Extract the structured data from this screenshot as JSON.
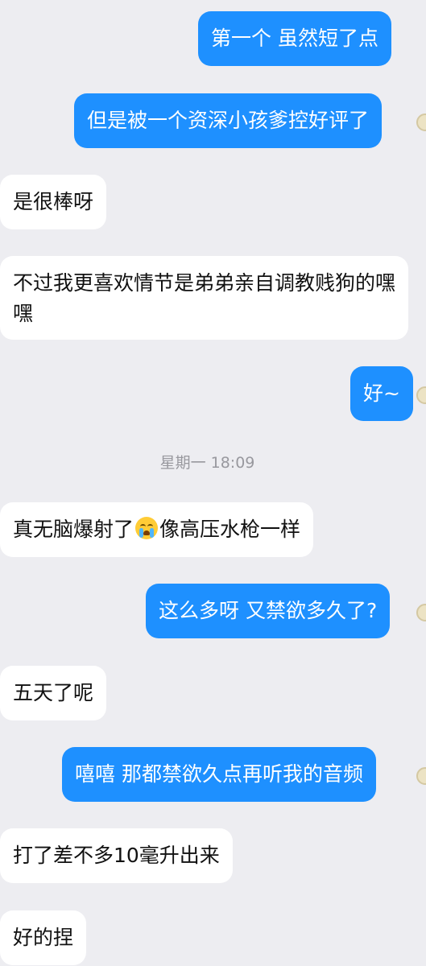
{
  "chat": {
    "messages": [
      {
        "text": "第一个  虽然短了点"
      },
      {
        "text": "但是被一个资深小孩爹控好评了"
      },
      {
        "text": "是很棒呀"
      },
      {
        "text": "不过我更喜欢情节是弟弟亲自调教贱狗的嘿嘿"
      },
      {
        "text": "好~"
      },
      {
        "text_before": "真无脑爆射了",
        "emoji": "loudly-crying-face",
        "text_after": "像高压水枪一样"
      },
      {
        "text": "这么多呀 又禁欲多久了?"
      },
      {
        "text": "五天了呢"
      },
      {
        "text": "嘻嘻  那都禁欲久点再听我的音频"
      },
      {
        "text": "打了差不多10毫升出来"
      },
      {
        "text": "好的捏"
      }
    ],
    "timestamp": "星期一 18:09"
  },
  "colors": {
    "background": "#ededf1",
    "sent_bubble": "#1e90ff",
    "received_bubble": "#ffffff"
  }
}
